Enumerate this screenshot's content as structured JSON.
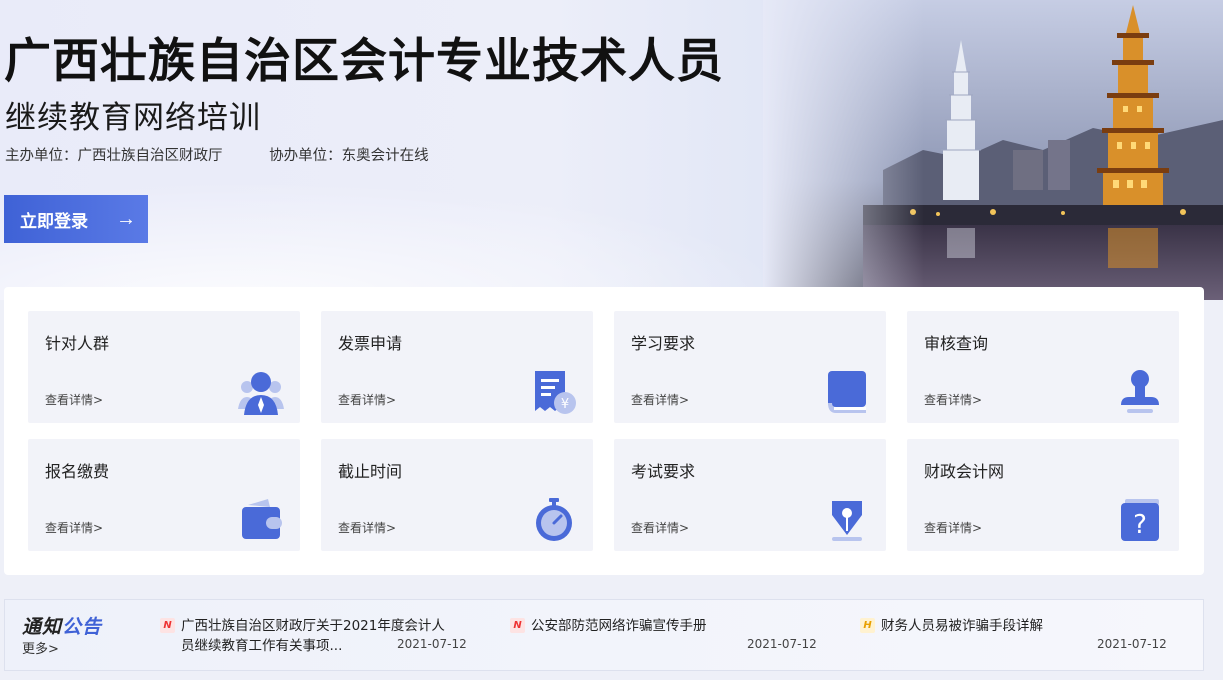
{
  "hero": {
    "title": "广西壮族自治区会计专业技术人员",
    "subtitle": "继续教育网络培训",
    "host": "主办单位：广西壮族自治区财政厅",
    "co_host": "协办单位：东奥会计在线",
    "login_label": "立即登录",
    "login_arrow": "→"
  },
  "cards": [
    {
      "title": "针对人群",
      "more": "查看详情>",
      "icon": "user-group-icon"
    },
    {
      "title": "发票申请",
      "more": "查看详情>",
      "icon": "invoice-icon"
    },
    {
      "title": "学习要求",
      "more": "查看详情>",
      "icon": "book-icon"
    },
    {
      "title": "审核查询",
      "more": "查看详情>",
      "icon": "stamp-icon"
    },
    {
      "title": "报名缴费",
      "more": "查看详情>",
      "icon": "wallet-icon"
    },
    {
      "title": "截止时间",
      "more": "查看详情>",
      "icon": "stopwatch-icon"
    },
    {
      "title": "考试要求",
      "more": "查看详情>",
      "icon": "pen-nib-icon"
    },
    {
      "title": "财政会计网",
      "more": "查看详情>",
      "icon": "question-icon"
    }
  ],
  "notice": {
    "brand_part1": "通知",
    "brand_part2": "公告",
    "more": "更多>",
    "items": [
      {
        "badge": "N",
        "line1": "广西壮族自治区财政厅关于2021年度会计人",
        "line2": "员继续教育工作有关事项...",
        "date": "2021-07-12"
      },
      {
        "badge": "N",
        "line1": "公安部防范网络诈骗宣传手册",
        "line2": "",
        "date": "2021-07-12"
      },
      {
        "badge": "H",
        "line1": "财务人员易被诈骗手段详解",
        "line2": "",
        "date": "2021-07-12"
      }
    ]
  },
  "colors": {
    "accent": "#3f62d6",
    "icon_blue": "#4a6ad8",
    "card_bg": "#f2f3f9",
    "badge_red": "#e33333",
    "badge_yellow": "#e8a000"
  }
}
